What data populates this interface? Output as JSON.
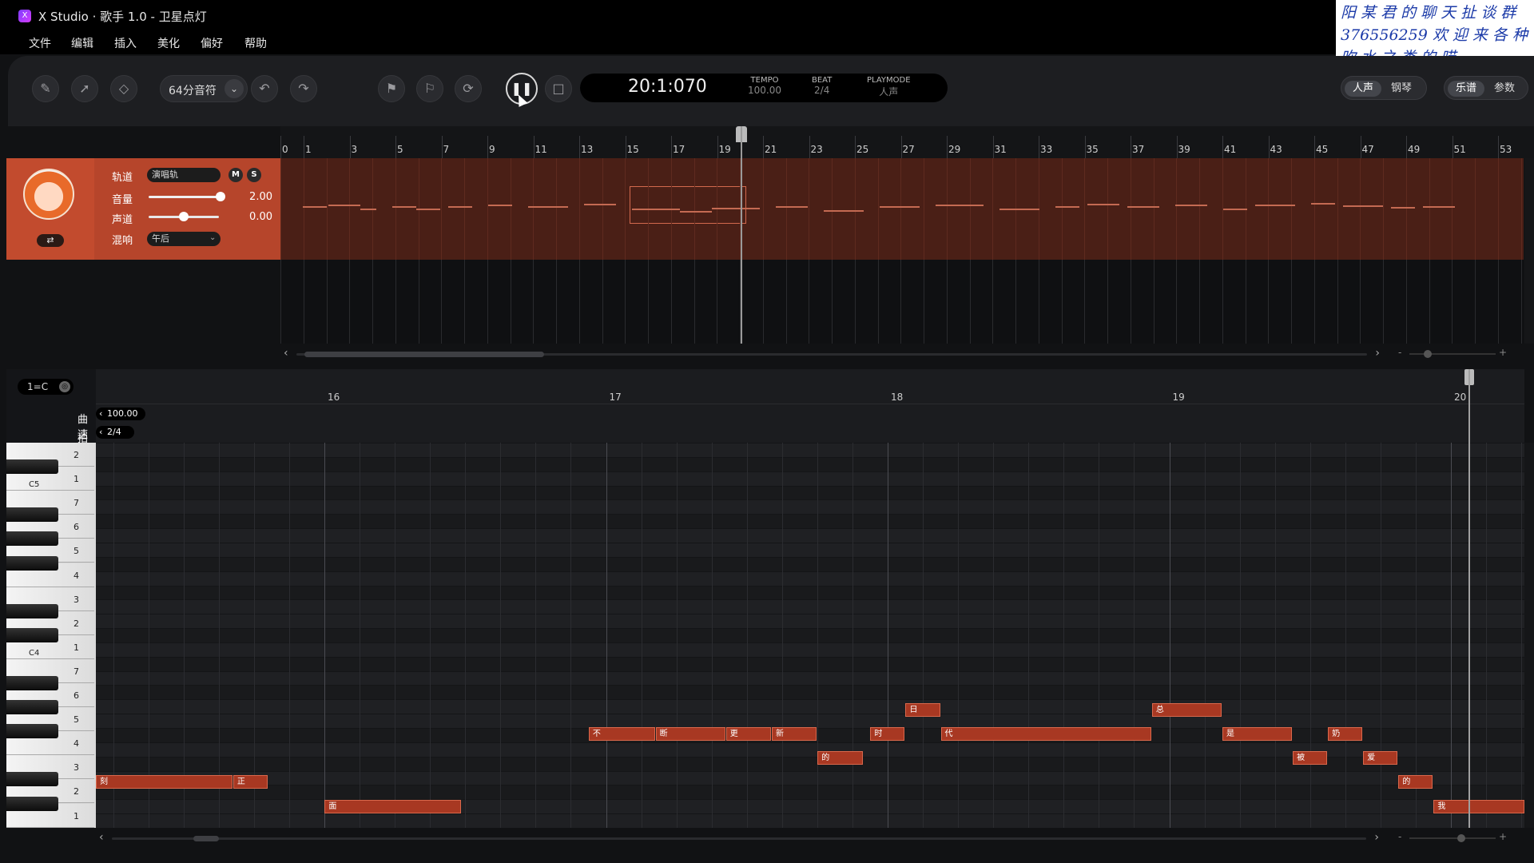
{
  "window": {
    "title": "X Studio · 歌手 1.0 - 卫星点灯",
    "logo": "X"
  },
  "menu": [
    "文件",
    "编辑",
    "插入",
    "美化",
    "偏好",
    "帮助"
  ],
  "watermark": [
    "阳 某 君 的 聊 天 扯 谈 群",
    "376556259 欢 迎 来 各 种",
    "吹 水 之 类 的 喵~~~~~~"
  ],
  "toolbar": {
    "snap_value": "64分音符",
    "time": "20:1:070",
    "tempo_label": "TEMPO",
    "tempo_value": "100.00",
    "beat_label": "BEAT",
    "beat_value": "2/4",
    "playmode_label": "PLAYMODE",
    "playmode_value": "人声",
    "view_left": [
      "人声",
      "钢琴"
    ],
    "view_right": [
      "乐谱",
      "参数"
    ]
  },
  "arrangement": {
    "ruler": [
      "0",
      "1",
      "3",
      "5",
      "7",
      "9",
      "11",
      "13",
      "15",
      "17",
      "19",
      "21",
      "23",
      "25",
      "27",
      "29",
      "31",
      "33",
      "35",
      "37",
      "39",
      "41",
      "43",
      "45",
      "47",
      "49",
      "51",
      "53"
    ]
  },
  "track": {
    "track_label": "轨道",
    "track_name": "演唱轨",
    "mute": "M",
    "solo": "S",
    "volume_label": "音量",
    "volume_value": "2.00",
    "pan_label": "声道",
    "pan_value": "0.00",
    "reverb_label": "混响",
    "reverb_value": "午后",
    "swap_icon": "⇄"
  },
  "piano_roll": {
    "key": "1=C",
    "tempo_label": "曲速",
    "tempo_value": "100.00",
    "meter_label": "拍号",
    "meter_value": "2/4",
    "bars": [
      "16",
      "17",
      "18",
      "19",
      "20"
    ],
    "key_degrees": [
      "2",
      "1",
      "7",
      "6",
      "5",
      "4",
      "3",
      "2",
      "1",
      "7",
      "6",
      "5",
      "4",
      "3",
      "2",
      "1"
    ],
    "octave_labels": [
      "C5",
      "C4"
    ],
    "notes": [
      {
        "text": "刻",
        "row": 13,
        "start": 0.0,
        "len": 1.95
      },
      {
        "text": "正",
        "row": 13,
        "start": 1.95,
        "len": 0.5
      },
      {
        "text": "面",
        "row": 14,
        "start": 3.25,
        "len": 1.95
      },
      {
        "text": "不",
        "row": 11,
        "start": 7.0,
        "len": 0.95
      },
      {
        "text": "断",
        "row": 11,
        "start": 7.95,
        "len": 1.0
      },
      {
        "text": "更",
        "row": 11,
        "start": 8.95,
        "len": 0.65
      },
      {
        "text": "新",
        "row": 11,
        "start": 9.6,
        "len": 0.65
      },
      {
        "text": "的",
        "row": 12,
        "start": 10.25,
        "len": 0.65
      },
      {
        "text": "时",
        "row": 11,
        "start": 11.0,
        "len": 0.5
      },
      {
        "text": "日",
        "row": 10,
        "start": 11.5,
        "len": 0.5
      },
      {
        "text": "代",
        "row": 11,
        "start": 12.0,
        "len": 3.0
      },
      {
        "text": "总",
        "row": 10,
        "start": 15.0,
        "len": 1.0
      },
      {
        "text": "是",
        "row": 11,
        "start": 16.0,
        "len": 1.0
      },
      {
        "text": "被",
        "row": 12,
        "start": 17.0,
        "len": 0.5
      },
      {
        "text": "奶",
        "row": 11,
        "start": 17.5,
        "len": 0.5
      },
      {
        "text": "爱",
        "row": 12,
        "start": 18.0,
        "len": 0.5
      },
      {
        "text": "的",
        "row": 13,
        "start": 18.5,
        "len": 0.5
      },
      {
        "text": "我",
        "row": 14,
        "start": 19.0,
        "len": 1.3
      }
    ]
  }
}
